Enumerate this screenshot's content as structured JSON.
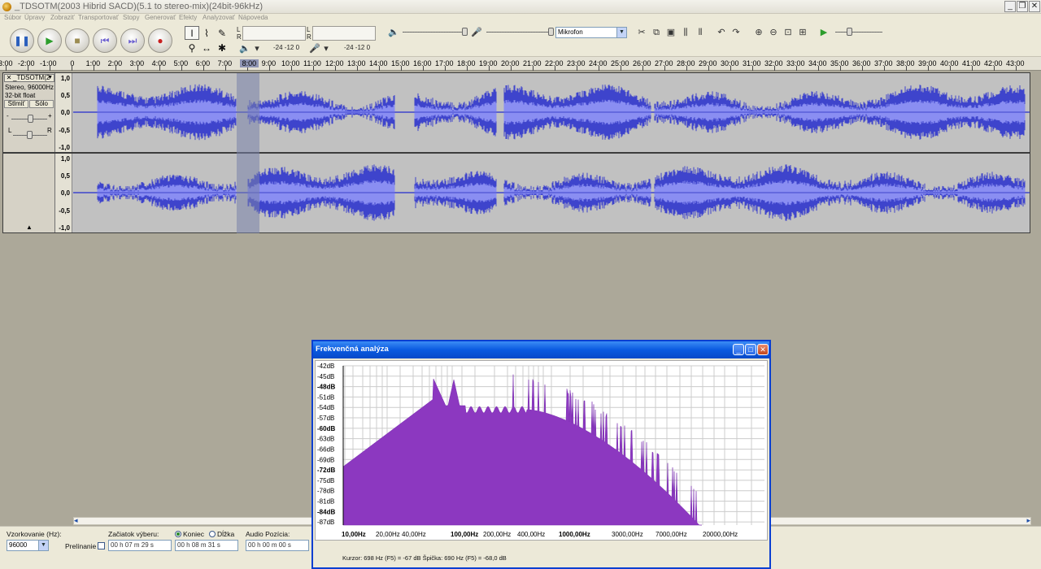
{
  "window": {
    "title": "_TDSOTM(2003 Hibrid SACD)(5.1 to stereo-mix)(24bit-96kHz)"
  },
  "menu": [
    "Súbor",
    "Úpravy",
    "Zobraziť",
    "Transportovať",
    "Stopy",
    "Generovať",
    "Efekty",
    "Analyzovať",
    "Nápoveda"
  ],
  "toolbar": {
    "transport": [
      {
        "name": "pause-button",
        "icon": "pause-icon",
        "glyph": "❚❚",
        "color": "#2b5fbd"
      },
      {
        "name": "play-button",
        "icon": "play-icon",
        "glyph": "▶",
        "color": "#2c9d2c"
      },
      {
        "name": "stop-button",
        "icon": "stop-icon",
        "glyph": "■",
        "color": "#9b8c52"
      },
      {
        "name": "skip-start-button",
        "icon": "skip-start-icon",
        "glyph": "⏮",
        "color": "#6b5fd0"
      },
      {
        "name": "skip-end-button",
        "icon": "skip-end-icon",
        "glyph": "⏭",
        "color": "#6b5fd0"
      },
      {
        "name": "record-button",
        "icon": "record-icon",
        "glyph": "●",
        "color": "#c82020"
      }
    ],
    "meter_scale_play": "-24 -12 0",
    "meter_scale_rec": "-24 -12 0",
    "meter_L": "L",
    "meter_R": "R",
    "input_source": "Mikrofon"
  },
  "ruler": {
    "labels": [
      "-3:00",
      "-2:00",
      "-1:00",
      "0",
      "1:00",
      "2:00",
      "3:00",
      "4:00",
      "5:00",
      "6:00",
      "7:00",
      "8:00",
      "9:00",
      "10:00",
      "11:00",
      "12:00",
      "13:00",
      "14:00",
      "15:00",
      "16:00",
      "17:00",
      "18:00",
      "19:00",
      "20:00",
      "21:00",
      "22:00",
      "23:00",
      "24:00",
      "25:00",
      "26:00",
      "27:00",
      "28:00",
      "29:00",
      "30:00",
      "31:00",
      "32:00",
      "33:00",
      "34:00",
      "35:00",
      "36:00",
      "37:00",
      "38:00",
      "39:00",
      "40:00",
      "41:00",
      "42:00",
      "43:00"
    ],
    "highlighted": "8:00"
  },
  "track": {
    "name": "_TDSOTM(2",
    "info1": "Stereo, 96000Hz",
    "info2": "32-bit float",
    "mute": "Stlmiť",
    "solo": "Sólo",
    "gain_minus": "-",
    "gain_plus": "+",
    "pan_L": "L",
    "pan_R": "R",
    "vlabels": [
      "1,0",
      "0,5",
      "0,0",
      "-0,5",
      "-1,0"
    ],
    "wave_color": "#3e44cc",
    "wave_light": "#8a8ef2"
  },
  "bottom": {
    "rate_label": "Vzorkovanie (Hz):",
    "rate_value": "96000",
    "overlap_label": "Prelínanie",
    "start_label": "Začiatok výberu:",
    "end_label": "Koniec",
    "length_label": "Dĺžka",
    "pos_label": "Audio Pozícia:",
    "start_value": "00 h 07 m 29 s",
    "end_value": "00 h 08 m 31 s",
    "pos_value": "00 h 00 m 00 s"
  },
  "freq": {
    "title": "Frekvenčná analýza",
    "ylabels": [
      "-42dB",
      "-45dB",
      "-48dB",
      "-51dB",
      "-54dB",
      "-57dB",
      "-60dB",
      "-63dB",
      "-66dB",
      "-69dB",
      "-72dB",
      "-75dB",
      "-78dB",
      "-81dB",
      "-84dB",
      "-87dB"
    ],
    "ylabels_bold": [
      "-48dB",
      "-60dB",
      "-72dB",
      "-84dB"
    ],
    "xlabels": [
      "10,00Hz",
      "20,00Hz",
      "40,00Hz",
      "100,00Hz",
      "200,00Hz",
      "400,00Hz",
      "1000,00Hz",
      "3000,00Hz",
      "7000,00Hz",
      "20000,00Hz"
    ],
    "xlabels_bold": [
      "10,00Hz",
      "100,00Hz",
      "1000,00Hz"
    ],
    "cursor_text": "Kurzor: 698 Hz (F5) = -67 dB    Špička: 690 Hz (F5) = -68,0 dB",
    "fill": "#8c38c0"
  }
}
